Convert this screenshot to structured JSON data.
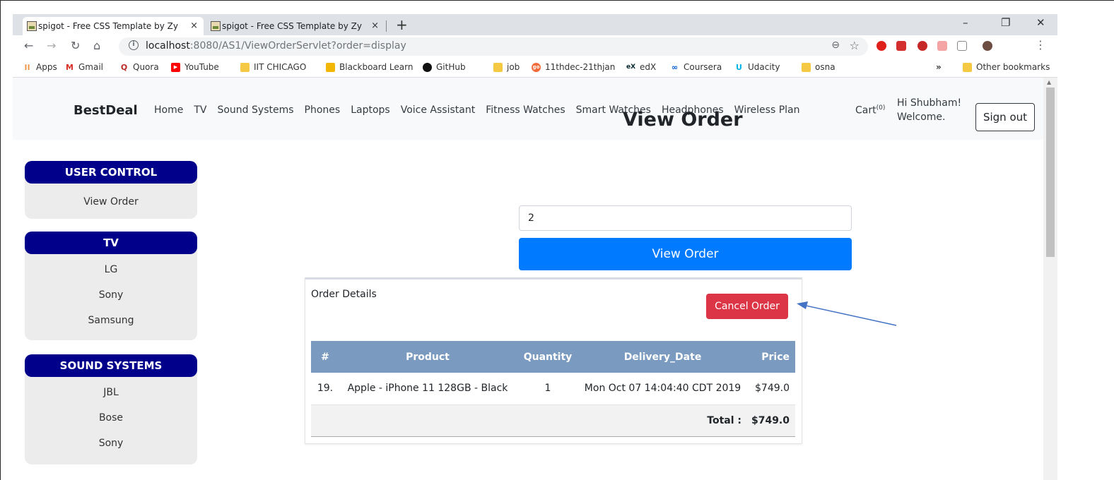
{
  "browser": {
    "tabs": [
      {
        "title": "spigot - Free CSS Template by Zy",
        "close": "×"
      },
      {
        "title": "spigot - Free CSS Template by Zy",
        "close": "×"
      }
    ],
    "new_tab": "+",
    "window_controls": {
      "minimize": "–",
      "restore": "❐",
      "close": "✕"
    },
    "url_host": "localhost",
    "url_rest": ":8080/AS1/ViewOrderServlet?order=display",
    "bookmarks": [
      {
        "label": "Apps",
        "icon": "apps-grid-icon"
      },
      {
        "label": "Gmail",
        "icon": "gmail-icon"
      },
      {
        "label": "Quora",
        "icon": "quora-icon"
      },
      {
        "label": "YouTube",
        "icon": "youtube-icon"
      },
      {
        "label": "IIT CHICAGO",
        "icon": "folder-icon"
      },
      {
        "label": "Blackboard Learn",
        "icon": "blackboard-icon"
      },
      {
        "label": "GitHub",
        "icon": "github-icon"
      },
      {
        "label": "job",
        "icon": "folder-icon"
      },
      {
        "label": "11thdec-21thjan",
        "icon": "go-icon"
      },
      {
        "label": "edX",
        "icon": "edx-icon"
      },
      {
        "label": "Coursera",
        "icon": "coursera-icon"
      },
      {
        "label": "Udacity",
        "icon": "udacity-icon"
      },
      {
        "label": "osna",
        "icon": "folder-icon"
      }
    ],
    "more_bookmarks": "»",
    "other_bookmarks": "Other bookmarks"
  },
  "navbar": {
    "brand": "BestDeal",
    "links": [
      "Home",
      "TV",
      "Sound Systems",
      "Phones",
      "Laptops",
      "Voice Assistant",
      "Fitness Watches",
      "Smart Watches",
      "Headphones",
      "Wireless Plan"
    ],
    "cart_label": "Cart",
    "cart_count": "(0)",
    "greeting_line1": "Hi Shubham!",
    "greeting_line2": "Welcome.",
    "signout": "Sign out"
  },
  "sidebar": [
    {
      "title": "USER CONTROL",
      "items": [
        "View Order"
      ]
    },
    {
      "title": "TV",
      "items": [
        "LG",
        "Sony",
        "Samsung"
      ]
    },
    {
      "title": "SOUND SYSTEMS",
      "items": [
        "JBL",
        "Bose",
        "Sony"
      ]
    }
  ],
  "main": {
    "title": "View Order",
    "order_input_value": "2",
    "view_button": "View Order",
    "details_title": "Order Details",
    "cancel_button": "Cancel Order",
    "table_headers": [
      "#",
      "Product",
      "Quantity",
      "Delivery_Date",
      "Price"
    ],
    "rows": [
      {
        "num": "19.",
        "product": "Apple - iPhone 11 128GB - Black",
        "qty": "1",
        "date": "Mon Oct 07 14:04:40 CDT 2019",
        "price": "$749.0"
      }
    ],
    "total_label": "Total :",
    "total_value": "$749.0"
  },
  "colors": {
    "sidebar_header": "#00008b",
    "primary_button": "#007bff",
    "danger_button": "#dc3545",
    "table_header": "#7a9bbf",
    "annotation_arrow": "#4472c4"
  }
}
